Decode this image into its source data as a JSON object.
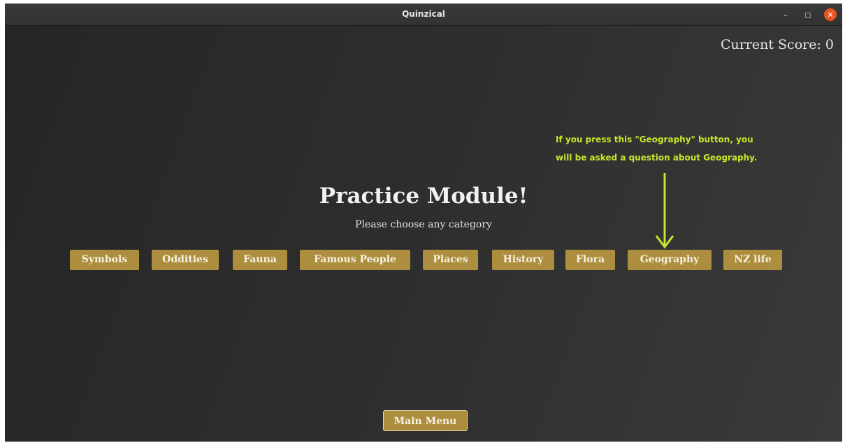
{
  "window": {
    "title": "Quinzical",
    "controls": {
      "minimize": "–",
      "maximize": "◻",
      "close": "✕"
    }
  },
  "score": {
    "label": "Current Score: 0"
  },
  "annotation": {
    "line1": "If you press this \"Geography\" button, you",
    "line2": "will be asked a question about Geography.",
    "color": "#c6e82a"
  },
  "page": {
    "title": "Practice Module!",
    "subtitle": "Please choose any category"
  },
  "categories": [
    "Symbols",
    "Oddities",
    "Fauna",
    "Famous People",
    "Places",
    "History",
    "Flora",
    "Geography",
    "NZ life"
  ],
  "footer": {
    "main_menu_label": "Main Menu"
  },
  "colors": {
    "button": "#ad8d3e",
    "background": "#2b2b2b",
    "close_button": "#e95420"
  }
}
